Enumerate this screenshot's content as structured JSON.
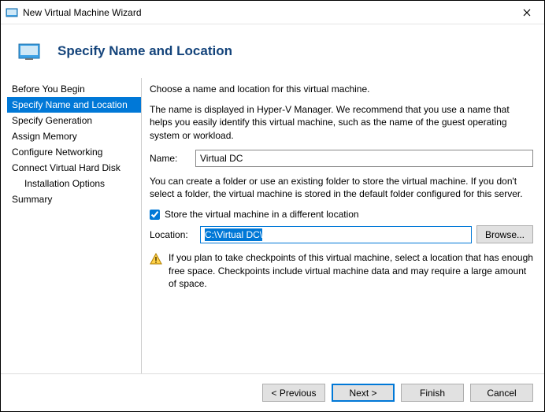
{
  "window": {
    "title": "New Virtual Machine Wizard"
  },
  "header": {
    "title": "Specify Name and Location"
  },
  "sidebar": {
    "steps": [
      "Before You Begin",
      "Specify Name and Location",
      "Specify Generation",
      "Assign Memory",
      "Configure Networking",
      "Connect Virtual Hard Disk",
      "Installation Options",
      "Summary"
    ],
    "selected_index": 1,
    "indent_indices": [
      6
    ]
  },
  "content": {
    "intro": "Choose a name and location for this virtual machine.",
    "name_help": "The name is displayed in Hyper-V Manager. We recommend that you use a name that helps you easily identify this virtual machine, such as the name of the guest operating system or workload.",
    "name_label": "Name:",
    "name_value": "Virtual DC",
    "folder_help": "You can create a folder or use an existing folder to store the virtual machine. If you don't select a folder, the virtual machine is stored in the default folder configured for this server.",
    "store_checkbox_label": "Store the virtual machine in a different location",
    "store_checkbox_checked": true,
    "location_label": "Location:",
    "location_value": "C:\\Virtual DC\\",
    "browse_label": "Browse...",
    "warning_text": "If you plan to take checkpoints of this virtual machine, select a location that has enough free space. Checkpoints include virtual machine data and may require a large amount of space."
  },
  "footer": {
    "previous": "< Previous",
    "next": "Next >",
    "finish": "Finish",
    "cancel": "Cancel"
  }
}
